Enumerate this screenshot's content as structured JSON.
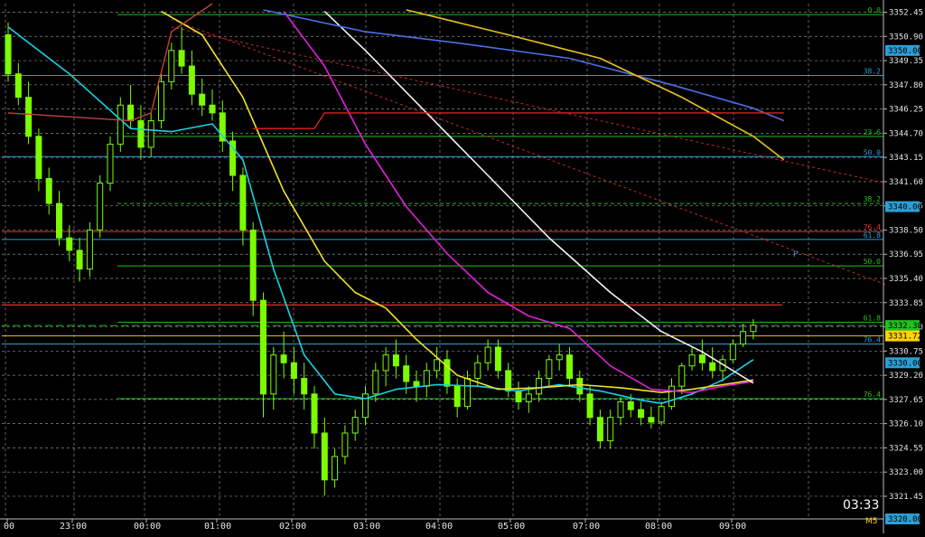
{
  "clock": "03:33",
  "timeframe": "M5",
  "colors": {
    "background": "#000000",
    "candle": "#7CFC00",
    "grid": "#8a8a8a",
    "ma_cyan": "#19d3e6",
    "ma_yellow": "#f0e130",
    "ma_magenta": "#e020d8",
    "ma_white": "#f2f2f2",
    "ma_blue": "#4d6fe6",
    "ma_gold": "#e8c21a",
    "ma_red": "#c04040",
    "fib_green": "#22c022",
    "fib_blue": "#2a9fd6",
    "fib_red": "#d43a3a",
    "price_box_green": "#22c022",
    "price_box_yellow": "#ffd400"
  },
  "chart_data": {
    "type": "candlestick",
    "ylim": [
      3320.0,
      3353.0
    ],
    "y_ticks": [
      "3352.45",
      "3350.90",
      "3349.35",
      "3347.80",
      "3346.25",
      "3344.70",
      "3343.15",
      "3341.60",
      "3340.05",
      "3338.50",
      "3336.95",
      "3335.40",
      "3333.85",
      "3332.30",
      "3330.75",
      "3329.20",
      "3327.65",
      "3326.10",
      "3324.55",
      "3323.00",
      "3321.45"
    ],
    "x_ticks": [
      "00",
      "23:00",
      "00:00",
      "01:00",
      "02:00",
      "03:00",
      "04:00",
      "05:00",
      "07:00",
      "08:00",
      "09:00"
    ],
    "price_boxes": [
      {
        "value": "3350.00",
        "color": "#2a9fd6"
      },
      {
        "value": "3340.00",
        "color": "#2a9fd6"
      },
      {
        "value": "3332.38",
        "color": "#22c022"
      },
      {
        "value": "3331.72",
        "color": "#ffd400"
      },
      {
        "value": "3330.00",
        "color": "#2a9fd6"
      },
      {
        "value": "3320.00",
        "color": "#2a9fd6"
      }
    ],
    "fib_levels": [
      {
        "label": "0.0",
        "price": 3352.3,
        "color": "#22c022",
        "dashed": false
      },
      {
        "label": "38.2",
        "price": 3348.4,
        "color": "#2a9fd6",
        "dashed": false
      },
      {
        "label": "23.6",
        "price": 3344.5,
        "color": "#22c022",
        "dashed": false
      },
      {
        "label": "50.0",
        "price": 3343.2,
        "color": "#2a9fd6",
        "dashed": false
      },
      {
        "label": "38.2",
        "price": 3340.2,
        "color": "#22c022",
        "dashed": true
      },
      {
        "label": "76.4",
        "price": 3338.4,
        "color": "#d43a3a",
        "dashed": false
      },
      {
        "label": "61.8",
        "price": 3337.9,
        "color": "#2a9fd6",
        "dashed": false
      },
      {
        "label": "50.0",
        "price": 3336.2,
        "color": "#22c022",
        "dashed": false
      },
      {
        "label": "61.8",
        "price": 3332.6,
        "color": "#22c022",
        "dashed": false
      },
      {
        "label": "76.4",
        "price": 3331.2,
        "color": "#2a9fd6",
        "dashed": false
      },
      {
        "label": "76.4",
        "price": 3327.7,
        "color": "#22c022",
        "dashed": false
      }
    ],
    "marker": "P",
    "candles": [
      [
        3351.0,
        3351.8,
        3348.0,
        3348.5
      ],
      [
        3348.5,
        3349.2,
        3346.5,
        3347.0
      ],
      [
        3347.0,
        3348.0,
        3344.0,
        3344.5
      ],
      [
        3344.5,
        3345.0,
        3341.0,
        3341.8
      ],
      [
        3341.8,
        3342.5,
        3339.5,
        3340.2
      ],
      [
        3340.2,
        3341.0,
        3337.5,
        3338.0
      ],
      [
        3338.0,
        3338.8,
        3336.5,
        3337.2
      ],
      [
        3337.2,
        3338.0,
        3335.2,
        3336.0
      ],
      [
        3336.0,
        3339.0,
        3335.5,
        3338.5
      ],
      [
        3338.5,
        3342.0,
        3338.0,
        3341.5
      ],
      [
        3341.5,
        3344.5,
        3341.0,
        3344.0
      ],
      [
        3344.0,
        3347.0,
        3343.5,
        3346.5
      ],
      [
        3346.5,
        3347.8,
        3345.0,
        3345.5
      ],
      [
        3345.5,
        3346.5,
        3343.0,
        3343.8
      ],
      [
        3343.8,
        3346.0,
        3343.2,
        3345.5
      ],
      [
        3345.5,
        3348.5,
        3345.0,
        3348.0
      ],
      [
        3348.0,
        3350.5,
        3347.5,
        3350.0
      ],
      [
        3350.0,
        3351.5,
        3348.5,
        3349.0
      ],
      [
        3349.0,
        3350.0,
        3346.5,
        3347.2
      ],
      [
        3347.2,
        3348.2,
        3345.8,
        3346.5
      ],
      [
        3346.5,
        3347.5,
        3345.5,
        3346.0
      ],
      [
        3346.0,
        3346.8,
        3343.5,
        3344.2
      ],
      [
        3344.2,
        3344.8,
        3341.0,
        3342.0
      ],
      [
        3342.0,
        3342.5,
        3337.5,
        3338.5
      ],
      [
        3338.5,
        3339.0,
        3333.0,
        3334.0
      ],
      [
        3334.0,
        3334.5,
        3326.5,
        3328.0
      ],
      [
        3328.0,
        3331.0,
        3327.0,
        3330.5
      ],
      [
        3330.5,
        3332.0,
        3329.0,
        3330.0
      ],
      [
        3330.0,
        3331.0,
        3328.0,
        3329.0
      ],
      [
        3329.0,
        3330.0,
        3327.0,
        3328.0
      ],
      [
        3328.0,
        3328.5,
        3324.5,
        3325.5
      ],
      [
        3325.5,
        3326.5,
        3321.5,
        3322.5
      ],
      [
        3322.5,
        3324.5,
        3322.0,
        3324.0
      ],
      [
        3324.0,
        3326.0,
        3323.5,
        3325.5
      ],
      [
        3325.5,
        3327.0,
        3325.0,
        3326.5
      ],
      [
        3326.5,
        3328.5,
        3326.0,
        3328.0
      ],
      [
        3328.0,
        3330.0,
        3327.5,
        3329.5
      ],
      [
        3329.5,
        3331.0,
        3328.5,
        3330.5
      ],
      [
        3330.5,
        3331.5,
        3329.0,
        3329.8
      ],
      [
        3329.8,
        3330.5,
        3328.0,
        3328.8
      ],
      [
        3328.8,
        3329.5,
        3327.5,
        3328.5
      ],
      [
        3328.5,
        3330.0,
        3327.8,
        3329.5
      ],
      [
        3329.5,
        3331.0,
        3329.0,
        3330.2
      ],
      [
        3330.2,
        3330.8,
        3328.0,
        3328.5
      ],
      [
        3328.5,
        3329.0,
        3326.5,
        3327.2
      ],
      [
        3327.2,
        3329.5,
        3327.0,
        3329.0
      ],
      [
        3329.0,
        3330.5,
        3328.5,
        3330.0
      ],
      [
        3330.0,
        3331.5,
        3329.5,
        3331.0
      ],
      [
        3331.0,
        3331.5,
        3329.0,
        3329.5
      ],
      [
        3329.5,
        3330.0,
        3327.8,
        3328.2
      ],
      [
        3328.2,
        3328.8,
        3327.0,
        3327.5
      ],
      [
        3327.5,
        3328.5,
        3326.8,
        3328.0
      ],
      [
        3328.0,
        3329.5,
        3327.5,
        3329.0
      ],
      [
        3329.0,
        3330.5,
        3328.5,
        3330.2
      ],
      [
        3330.2,
        3331.2,
        3329.5,
        3330.5
      ],
      [
        3330.5,
        3331.0,
        3328.5,
        3329.0
      ],
      [
        3329.0,
        3329.5,
        3327.5,
        3328.0
      ],
      [
        3328.0,
        3328.5,
        3326.0,
        3326.5
      ],
      [
        3326.5,
        3327.0,
        3324.5,
        3325.0
      ],
      [
        3325.0,
        3327.0,
        3324.5,
        3326.5
      ],
      [
        3326.5,
        3327.8,
        3326.0,
        3327.5
      ],
      [
        3327.5,
        3328.0,
        3326.5,
        3327.0
      ],
      [
        3327.0,
        3327.5,
        3326.0,
        3326.5
      ],
      [
        3326.5,
        3327.2,
        3325.8,
        3326.2
      ],
      [
        3326.2,
        3327.5,
        3326.0,
        3327.2
      ],
      [
        3327.2,
        3329.0,
        3327.0,
        3328.5
      ],
      [
        3328.5,
        3330.0,
        3328.0,
        3329.8
      ],
      [
        3329.8,
        3331.0,
        3329.5,
        3330.5
      ],
      [
        3330.5,
        3331.5,
        3329.5,
        3330.0
      ],
      [
        3330.0,
        3331.0,
        3329.0,
        3329.5
      ],
      [
        3329.5,
        3330.5,
        3328.8,
        3330.2
      ],
      [
        3330.2,
        3331.5,
        3330.0,
        3331.2
      ],
      [
        3331.2,
        3332.5,
        3331.0,
        3332.0
      ],
      [
        3332.0,
        3332.8,
        3331.5,
        3332.4
      ]
    ],
    "moving_averages": [
      {
        "color": "#19d3e6",
        "points": [
          [
            0,
            3351.5
          ],
          [
            6,
            3348.5
          ],
          [
            12,
            3345.0
          ],
          [
            16,
            3344.8
          ],
          [
            20,
            3345.3
          ],
          [
            23,
            3343.0
          ],
          [
            26,
            3336.0
          ],
          [
            29,
            3330.5
          ],
          [
            32,
            3328.0
          ],
          [
            35,
            3327.7
          ],
          [
            38,
            3328.3
          ],
          [
            42,
            3328.6
          ],
          [
            46,
            3328.5
          ],
          [
            50,
            3328.2
          ],
          [
            54,
            3328.6
          ],
          [
            58,
            3328.2
          ],
          [
            62,
            3327.6
          ],
          [
            64,
            3327.4
          ],
          [
            67,
            3328.0
          ],
          [
            70,
            3328.9
          ],
          [
            73,
            3330.2
          ]
        ]
      },
      {
        "color": "#f0e130",
        "points": [
          [
            15,
            3352.5
          ],
          [
            19,
            3351.0
          ],
          [
            23,
            3347.0
          ],
          [
            27,
            3341.0
          ],
          [
            31,
            3336.5
          ],
          [
            34,
            3334.5
          ],
          [
            37,
            3333.5
          ],
          [
            40,
            3331.5
          ],
          [
            44,
            3329.2
          ],
          [
            48,
            3328.3
          ],
          [
            52,
            3328.4
          ],
          [
            56,
            3328.6
          ],
          [
            60,
            3328.4
          ],
          [
            64,
            3328.1
          ],
          [
            67,
            3328.3
          ],
          [
            70,
            3328.6
          ],
          [
            73,
            3328.9
          ]
        ]
      },
      {
        "color": "#e020d8",
        "points": [
          [
            27,
            3352.5
          ],
          [
            31,
            3349.0
          ],
          [
            35,
            3344.0
          ],
          [
            39,
            3340.0
          ],
          [
            43,
            3337.0
          ],
          [
            47,
            3334.5
          ],
          [
            51,
            3333.0
          ],
          [
            55,
            3332.2
          ],
          [
            59,
            3329.8
          ],
          [
            63,
            3328.3
          ],
          [
            67,
            3328.1
          ],
          [
            70,
            3328.5
          ],
          [
            73,
            3328.8
          ]
        ]
      },
      {
        "color": "#f2f2f2",
        "points": [
          [
            31,
            3352.5
          ],
          [
            35,
            3350.0
          ],
          [
            41,
            3346.0
          ],
          [
            47,
            3342.0
          ],
          [
            53,
            3338.0
          ],
          [
            59,
            3334.5
          ],
          [
            64,
            3332.0
          ],
          [
            68,
            3330.7
          ],
          [
            71,
            3329.5
          ],
          [
            73,
            3328.7
          ]
        ]
      },
      {
        "color": "#4d6fe6",
        "points": [
          [
            25,
            3352.6
          ],
          [
            35,
            3351.2
          ],
          [
            45,
            3350.4
          ],
          [
            55,
            3349.5
          ],
          [
            65,
            3347.8
          ],
          [
            73,
            3346.3
          ],
          [
            76,
            3345.5
          ]
        ]
      },
      {
        "color": "#e8c21a",
        "points": [
          [
            39,
            3352.6
          ],
          [
            49,
            3351.0
          ],
          [
            58,
            3349.5
          ],
          [
            66,
            3347.0
          ],
          [
            73,
            3344.5
          ],
          [
            76,
            3343.0
          ]
        ]
      }
    ],
    "red_ma": [
      [
        0,
        3346.0
      ],
      [
        12,
        3345.5
      ],
      [
        14,
        3346.0
      ],
      [
        16,
        3351.2
      ],
      [
        20,
        3353.0
      ]
    ],
    "red_step": [
      [
        24,
        3345.0
      ],
      [
        30,
        3345.0
      ],
      [
        31,
        3346.0
      ],
      [
        76,
        3346.0
      ]
    ],
    "red_hline": 3333.7,
    "trend_lines": [
      {
        "from": [
          16,
          3351.5
        ],
        "to": [
          86,
          3341.5
        ]
      },
      {
        "from": [
          16,
          3352.0
        ],
        "to": [
          86,
          3335.0
        ]
      }
    ]
  }
}
